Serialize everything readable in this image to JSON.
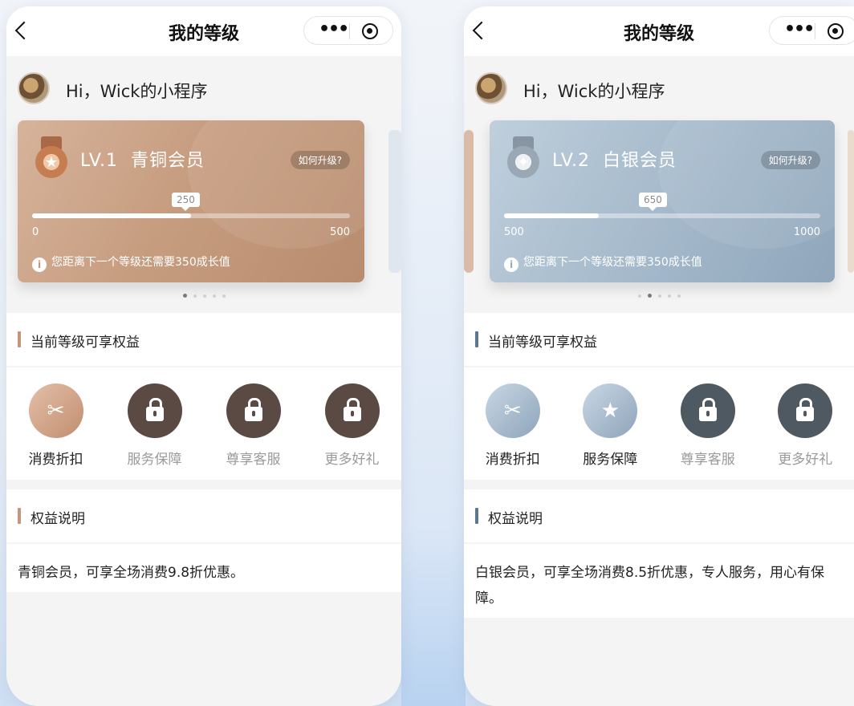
{
  "screens": [
    {
      "nav": {
        "title": "我的等级",
        "more_glyph": "•••"
      },
      "greeting": "Hi，Wick的小程序",
      "card": {
        "level": "LV.1",
        "level_name": "青铜会员",
        "upgrade_label": "如何升级?",
        "current": "250",
        "min": "0",
        "max": "500",
        "progress": 0.5,
        "tip": "您距离下一个等级还需要350成长值",
        "medal_icon": "star-medal-icon"
      },
      "carousel_active_index": 0,
      "benefits_title": "当前等级可享权益",
      "benefits": [
        {
          "label": "消费折扣",
          "icon": "discount-tag-icon",
          "locked": false
        },
        {
          "label": "服务保障",
          "icon": "lock-icon",
          "locked": true
        },
        {
          "label": "尊享客服",
          "icon": "lock-icon",
          "locked": true
        },
        {
          "label": "更多好礼",
          "icon": "lock-icon",
          "locked": true
        }
      ],
      "explain_title": "权益说明",
      "explain_text": "青铜会员，可享全场消费9.8折优惠。"
    },
    {
      "nav": {
        "title": "我的等级",
        "more_glyph": "•••"
      },
      "greeting": "Hi，Wick的小程序",
      "card": {
        "level": "LV.2",
        "level_name": "白银会员",
        "upgrade_label": "如何升级?",
        "current": "650",
        "min": "500",
        "max": "1000",
        "progress": 0.3,
        "tip": "您距离下一个等级还需要350成长值",
        "medal_icon": "star-medal-icon"
      },
      "carousel_active_index": 1,
      "benefits_title": "当前等级可享权益",
      "benefits": [
        {
          "label": "消费折扣",
          "icon": "discount-tag-icon",
          "locked": false
        },
        {
          "label": "服务保障",
          "icon": "service-hand-star-icon",
          "locked": false
        },
        {
          "label": "尊享客服",
          "icon": "lock-icon",
          "locked": true
        },
        {
          "label": "更多好礼",
          "icon": "lock-icon",
          "locked": true
        }
      ],
      "explain_title": "权益说明",
      "explain_text": "白银会员，可享全场消费8.5折优惠，专人服务，用心有保障。"
    }
  ]
}
